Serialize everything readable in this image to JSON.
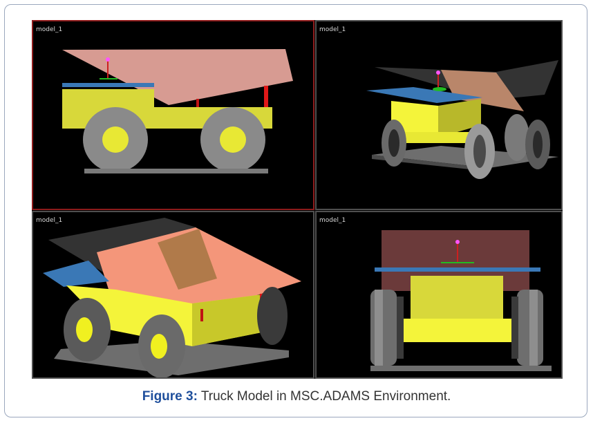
{
  "viewports": [
    {
      "label": "model_1"
    },
    {
      "label": "model_1"
    },
    {
      "label": "model_1"
    },
    {
      "label": "model_1"
    }
  ],
  "caption": {
    "label": "Figure 3:",
    "text": " Truck Model in MSC.ADAMS Environment."
  },
  "colors": {
    "viewport_background": "#000000",
    "active_viewport_border": "#8e1c1c",
    "viewport_border": "#505050",
    "truck_body": "#d8d83a",
    "dump_bed_side": "#d79b92",
    "dump_bed_orange": "#f4967a",
    "platform_blue": "#3a78b6",
    "tire_gray": "#8a8a8a",
    "rim_yellow": "#e8e834",
    "caption_label": "#1f4f9c"
  }
}
